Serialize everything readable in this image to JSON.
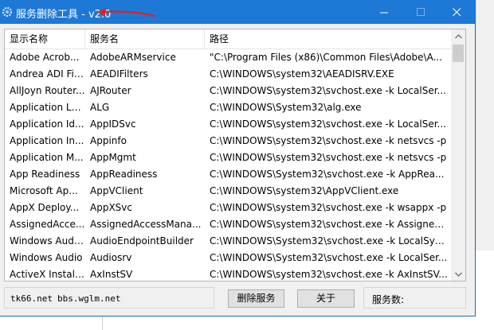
{
  "window": {
    "title": "服务删除工具 - v2.0",
    "icon": "gear-icon",
    "controls": [
      "minimize-icon",
      "maximize-icon",
      "close-icon"
    ]
  },
  "annotation": {
    "color": "#e0211d",
    "icon": "red-arrow-icon"
  },
  "list": {
    "columns": [
      "显示名称",
      "服务名",
      "路径"
    ],
    "rows": [
      [
        "Adobe Acrob...",
        "AdobeARMservice",
        "\"C:\\Program Files (x86)\\Common Files\\Adobe\\A..."
      ],
      [
        "Andrea ADI Fil...",
        "AEADIFilters",
        "C:\\WINDOWS\\system32\\AEADISRV.EXE"
      ],
      [
        "AllJoyn Router...",
        "AJRouter",
        "C:\\WINDOWS\\system32\\svchost.exe -k LocalSer..."
      ],
      [
        "Application La...",
        "ALG",
        "C:\\WINDOWS\\System32\\alg.exe"
      ],
      [
        "Application Id...",
        "AppIDSvc",
        "C:\\WINDOWS\\system32\\svchost.exe -k LocalSer..."
      ],
      [
        "Application In...",
        "Appinfo",
        "C:\\WINDOWS\\system32\\svchost.exe -k netsvcs -p"
      ],
      [
        "Application M...",
        "AppMgmt",
        "C:\\WINDOWS\\system32\\svchost.exe -k netsvcs -p"
      ],
      [
        "App Readiness",
        "AppReadiness",
        "C:\\WINDOWS\\System32\\svchost.exe -k AppRea..."
      ],
      [
        "Microsoft Ap...",
        "AppVClient",
        "C:\\WINDOWS\\system32\\AppVClient.exe"
      ],
      [
        "AppX Deploy...",
        "AppXSvc",
        "C:\\WINDOWS\\system32\\svchost.exe -k wsappx -p"
      ],
      [
        "AssignedAcce...",
        "AssignedAccessMana...",
        "C:\\WINDOWS\\system32\\svchost.exe -k Assigned..."
      ],
      [
        "Windows Audi...",
        "AudioEndpointBuilder",
        "C:\\WINDOWS\\System32\\svchost.exe -k LocalSyst..."
      ],
      [
        "Windows Audio",
        "Audiosrv",
        "C:\\WINDOWS\\System32\\svchost.exe -k LocalSer..."
      ],
      [
        "ActiveX Install...",
        "AxInstSV",
        "C:\\WINDOWS\\system32\\svchost.exe -k AxInstSV..."
      ]
    ]
  },
  "footer": {
    "site1": "tk66.net",
    "site2": "bbs.wglm.net",
    "delete_label": "删除服务",
    "about_label": "关于",
    "count_label": "服务数:"
  }
}
